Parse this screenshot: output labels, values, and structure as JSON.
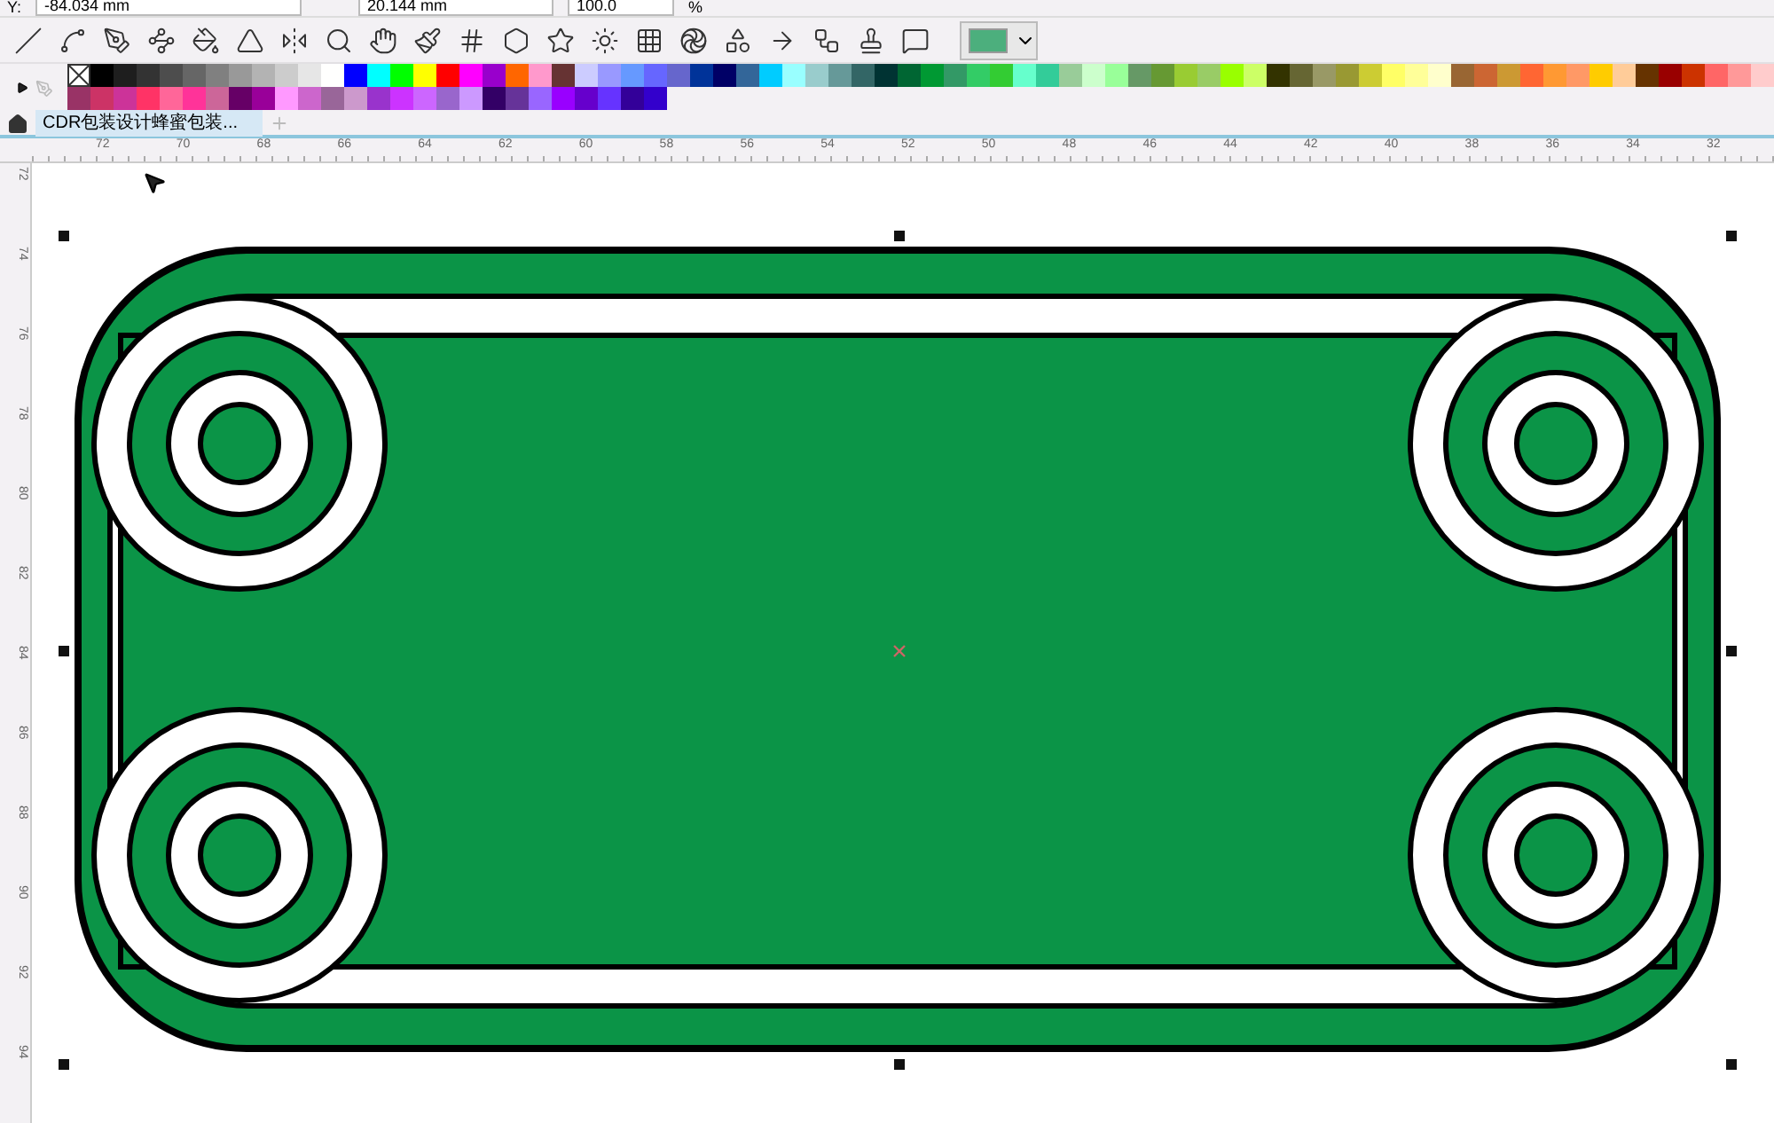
{
  "property_bar": {
    "y_label": "Y:",
    "y_value": "-84.034 mm",
    "height_value": "20.144 mm",
    "scale_value": "100.0",
    "scale_unit": "%"
  },
  "palette": {
    "row_1": [
      {
        "color": "#ffffff",
        "kind": "none"
      },
      {
        "color": "#000000"
      },
      {
        "color": "#1e1e1e"
      },
      {
        "color": "#333333"
      },
      {
        "color": "#4d4d4d"
      },
      {
        "color": "#666666"
      },
      {
        "color": "#808080"
      },
      {
        "color": "#999999"
      },
      {
        "color": "#b3b3b3"
      },
      {
        "color": "#cccccc"
      },
      {
        "color": "#e6e6e6"
      },
      {
        "color": "#fffffe"
      },
      {
        "color": "#0000ff"
      },
      {
        "color": "#00ffff"
      },
      {
        "color": "#00ff00"
      },
      {
        "color": "#ffff00"
      },
      {
        "color": "#ff0000"
      },
      {
        "color": "#ff00ff"
      },
      {
        "color": "#9900cc"
      },
      {
        "color": "#ff6600"
      },
      {
        "color": "#ff99cc"
      },
      {
        "color": "#663333"
      },
      {
        "color": "#ccccff"
      },
      {
        "color": "#9999ff"
      },
      {
        "color": "#6699ff"
      },
      {
        "color": "#6666ff"
      },
      {
        "color": "#6666cc"
      },
      {
        "color": "#003399"
      },
      {
        "color": "#000066"
      },
      {
        "color": "#336699"
      },
      {
        "color": "#00ccff"
      },
      {
        "color": "#99ffff"
      },
      {
        "color": "#99cccc"
      },
      {
        "color": "#669999"
      },
      {
        "color": "#336666"
      },
      {
        "color": "#003333"
      },
      {
        "color": "#006633"
      },
      {
        "color": "#009933"
      },
      {
        "color": "#339966"
      },
      {
        "color": "#33cc66"
      },
      {
        "color": "#33cc33"
      },
      {
        "color": "#66ffcc"
      },
      {
        "color": "#33cc99"
      },
      {
        "color": "#99cc99"
      },
      {
        "color": "#ccffcc"
      },
      {
        "color": "#99ff99"
      },
      {
        "color": "#669966"
      },
      {
        "color": "#669933"
      },
      {
        "color": "#99cc33"
      },
      {
        "color": "#99cc66"
      },
      {
        "color": "#99ff00"
      },
      {
        "color": "#ccff66"
      },
      {
        "color": "#333300"
      },
      {
        "color": "#666633"
      },
      {
        "color": "#999966"
      },
      {
        "color": "#999933"
      },
      {
        "color": "#cccc33"
      },
      {
        "color": "#ffff66"
      },
      {
        "color": "#ffff99"
      },
      {
        "color": "#ffffcc"
      },
      {
        "color": "#996633"
      },
      {
        "color": "#cc6633"
      },
      {
        "color": "#cc9933"
      },
      {
        "color": "#ff6633"
      },
      {
        "color": "#ff9933"
      },
      {
        "color": "#ff9966"
      },
      {
        "color": "#ffcc00"
      },
      {
        "color": "#ffcc99"
      },
      {
        "color": "#663300"
      },
      {
        "color": "#990000"
      },
      {
        "color": "#cc3300"
      },
      {
        "color": "#ff6666"
      },
      {
        "color": "#ff9999"
      },
      {
        "color": "#ffcccc"
      }
    ],
    "row_2": [
      {
        "color": "#993366"
      },
      {
        "color": "#cc3366"
      },
      {
        "color": "#cc3399"
      },
      {
        "color": "#ff3366"
      },
      {
        "color": "#ff6699"
      },
      {
        "color": "#ff3399"
      },
      {
        "color": "#cc6699"
      },
      {
        "color": "#660066"
      },
      {
        "color": "#990099"
      },
      {
        "color": "#ff99ff"
      },
      {
        "color": "#cc66cc"
      },
      {
        "color": "#996699"
      },
      {
        "color": "#cc99cc"
      },
      {
        "color": "#9933cc"
      },
      {
        "color": "#cc33ff"
      },
      {
        "color": "#cc66ff"
      },
      {
        "color": "#9966cc"
      },
      {
        "color": "#cc99ff"
      },
      {
        "color": "#330066"
      },
      {
        "color": "#663399"
      },
      {
        "color": "#9966ff"
      },
      {
        "color": "#9900ff"
      },
      {
        "color": "#6600cc"
      },
      {
        "color": "#6633ff"
      },
      {
        "color": "#330099"
      },
      {
        "color": "#3300cc"
      }
    ]
  },
  "document_tab": {
    "label": "CDR包装设计蜂蜜包装...",
    "selected": true
  },
  "horizontal_ruler": [
    "72",
    "70",
    "68",
    "66",
    "64",
    "62",
    "60",
    "58",
    "56",
    "54",
    "52",
    "50",
    "48",
    "46",
    "44",
    "42",
    "40",
    "38",
    "36",
    "34",
    "32"
  ],
  "vertical_ruler": [
    "72",
    "74",
    "76",
    "78",
    "80",
    "82",
    "84",
    "86",
    "88",
    "90",
    "92",
    "94"
  ]
}
